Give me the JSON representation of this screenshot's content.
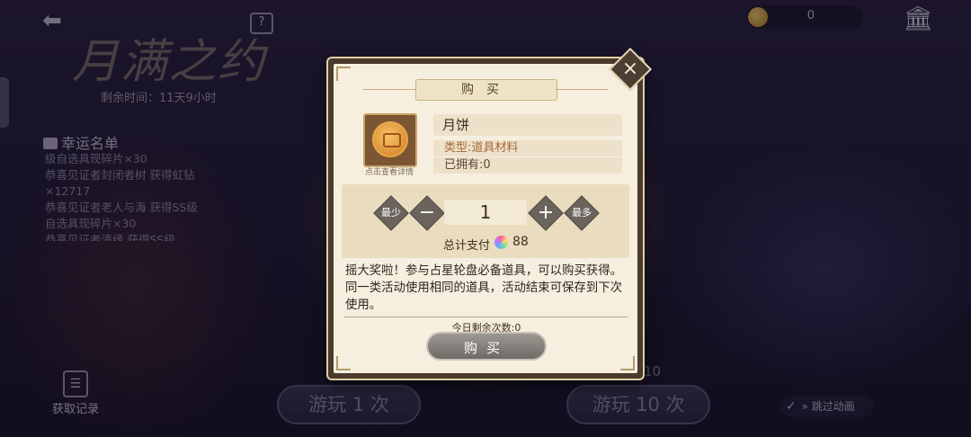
{
  "event": {
    "title": "月满之约",
    "remaining_time": "剩余时间：11天9小时"
  },
  "top_bar": {
    "coin_value": "0",
    "help_label": "?"
  },
  "lucky_list": {
    "heading": "幸运名单",
    "entries": [
      "级自选具现碎片×30",
      "恭喜见证者封闭者树 获得虹钻",
      "×12717",
      "恭喜见证者老人与海 获得SS级",
      "自选具现碎片×30",
      "恭喜见证者清缘    获得SS级"
    ]
  },
  "record": {
    "label": "获取记录"
  },
  "play": {
    "once_label": "游玩 1 次",
    "ten_label": "游玩 10 次",
    "ten_count": "10"
  },
  "skip_animation": {
    "label": "跳过动画",
    "prefix": "»"
  },
  "modal": {
    "title": "购买",
    "item": {
      "name": "月饼",
      "caption": "点击查看详情",
      "type": "类型:道具材料",
      "owned": "已拥有:0"
    },
    "quantity": {
      "min_label": "最少",
      "minus_label": "−",
      "value": "1",
      "plus_label": "+",
      "max_label": "最多"
    },
    "total": {
      "label": "总计支付",
      "value": "88"
    },
    "description": "摇大奖啦！参与占星轮盘必备道具，可以购买获得。同一类活动使用相同的道具，活动结束可保存到下次使用。",
    "today_remaining": "今日剩余次数:0",
    "buy_label": "购买",
    "close_label": "×"
  }
}
